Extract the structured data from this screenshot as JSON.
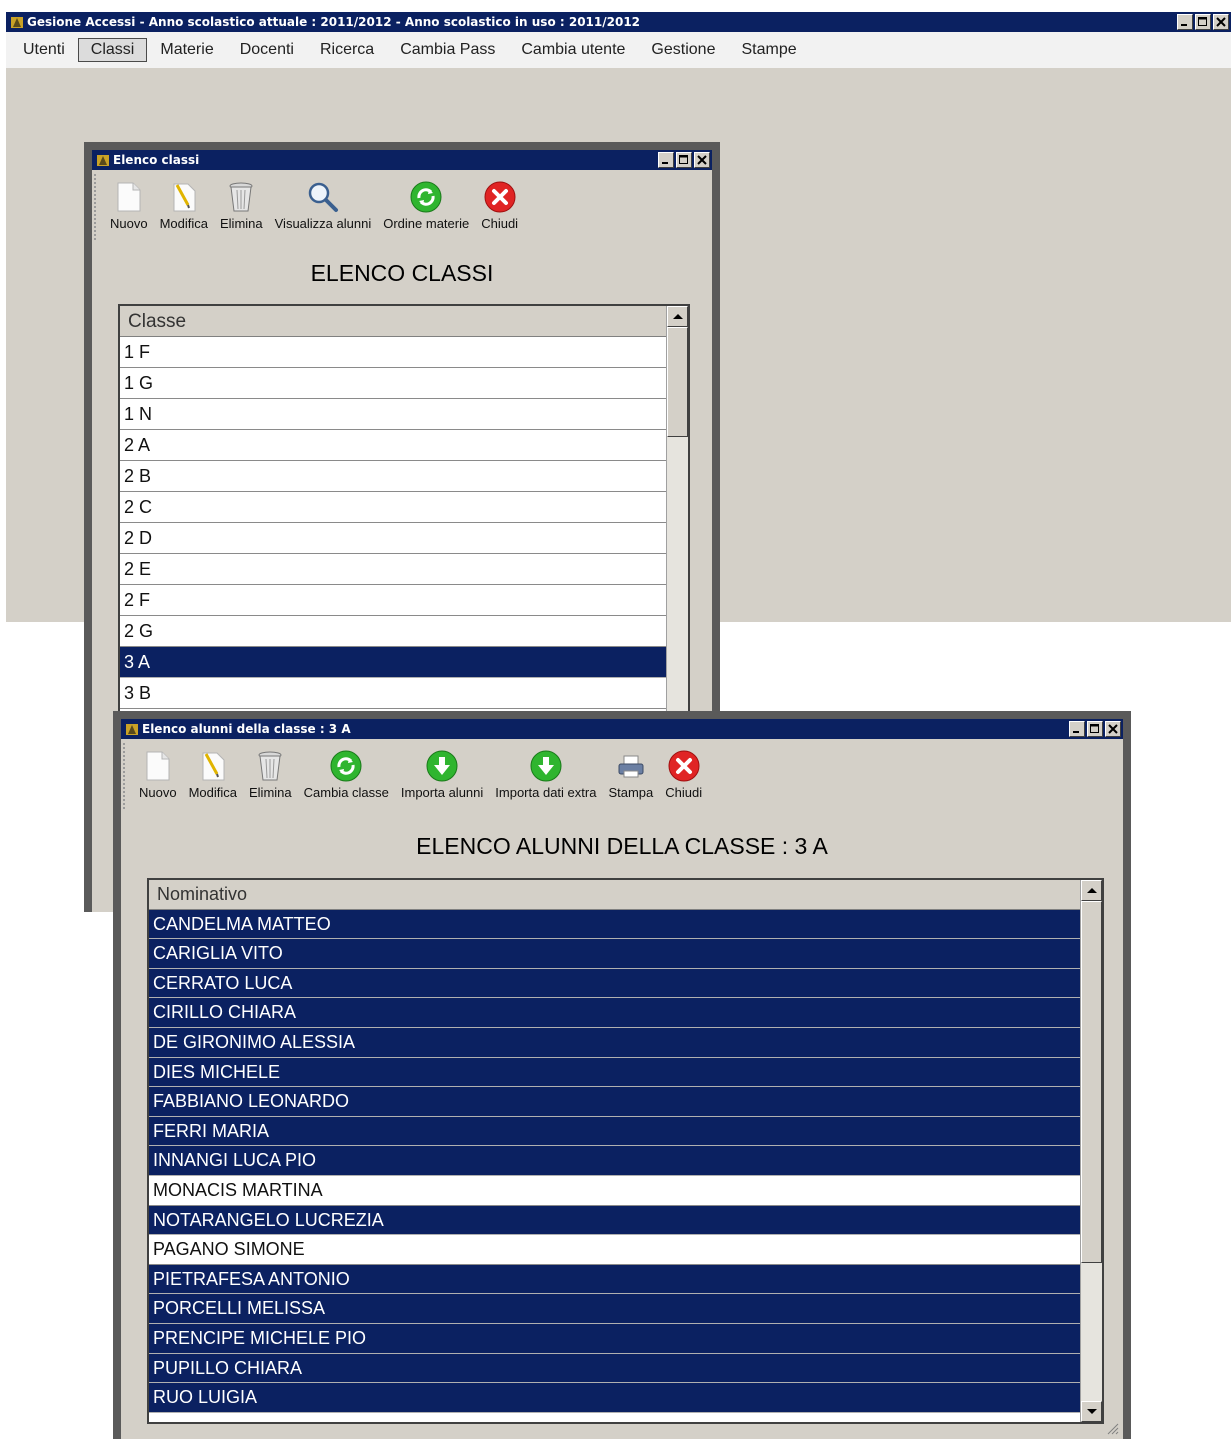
{
  "main_window": {
    "title": "Gesione Accessi - Anno scolastico attuale : 2011/2012 - Anno scolastico in uso : 2011/2012",
    "menu": [
      "Utenti",
      "Classi",
      "Materie",
      "Docenti",
      "Ricerca",
      "Cambia Pass",
      "Cambia utente",
      "Gestione",
      "Stampe"
    ],
    "active_menu": "Classi"
  },
  "classi_window": {
    "title": "Elenco classi",
    "toolbar": [
      {
        "label": "Nuovo",
        "icon": "new-document-icon"
      },
      {
        "label": "Modifica",
        "icon": "edit-document-icon"
      },
      {
        "label": "Elimina",
        "icon": "trash-icon"
      },
      {
        "label": "Visualizza alunni",
        "icon": "search-icon"
      },
      {
        "label": "Ordine materie",
        "icon": "refresh-icon"
      },
      {
        "label": "Chiudi",
        "icon": "close-icon"
      }
    ],
    "heading": "ELENCO CLASSI",
    "column": "Classe",
    "rows": [
      "1 F",
      "1 G",
      "1 N",
      "2 A",
      "2 B",
      "2 C",
      "2 D",
      "2 E",
      "2 F",
      "2 G",
      "3 A",
      "3 B"
    ],
    "selected": "3 A"
  },
  "alunni_window": {
    "title": "Elenco alunni della classe : 3 A",
    "toolbar": [
      {
        "label": "Nuovo",
        "icon": "new-document-icon"
      },
      {
        "label": "Modifica",
        "icon": "edit-document-icon"
      },
      {
        "label": "Elimina",
        "icon": "trash-icon"
      },
      {
        "label": "Cambia classe",
        "icon": "refresh-icon"
      },
      {
        "label": "Importa alunni",
        "icon": "download-icon"
      },
      {
        "label": "Importa dati extra",
        "icon": "download-icon"
      },
      {
        "label": "Stampa",
        "icon": "printer-icon"
      },
      {
        "label": "Chiudi",
        "icon": "close-icon"
      }
    ],
    "heading": "ELENCO ALUNNI DELLA CLASSE : 3 A",
    "column": "Nominativo",
    "rows": [
      {
        "name": "CANDELMA MATTEO",
        "selected": true
      },
      {
        "name": "CARIGLIA VITO",
        "selected": true
      },
      {
        "name": "CERRATO LUCA",
        "selected": true
      },
      {
        "name": "CIRILLO CHIARA",
        "selected": true
      },
      {
        "name": "DE GIRONIMO ALESSIA",
        "selected": true
      },
      {
        "name": "DIES MICHELE",
        "selected": true
      },
      {
        "name": "FABBIANO LEONARDO",
        "selected": true
      },
      {
        "name": "FERRI MARIA",
        "selected": true
      },
      {
        "name": "INNANGI LUCA PIO",
        "selected": true
      },
      {
        "name": "MONACIS MARTINA",
        "selected": false
      },
      {
        "name": "NOTARANGELO LUCREZIA",
        "selected": true
      },
      {
        "name": "PAGANO SIMONE",
        "selected": false
      },
      {
        "name": "PIETRAFESA ANTONIO",
        "selected": true
      },
      {
        "name": "PORCELLI MELISSA",
        "selected": true
      },
      {
        "name": "PRENCIPE MICHELE PIO",
        "selected": true
      },
      {
        "name": "PUPILLO CHIARA",
        "selected": true
      },
      {
        "name": "RUO LUIGIA",
        "selected": true
      }
    ]
  }
}
